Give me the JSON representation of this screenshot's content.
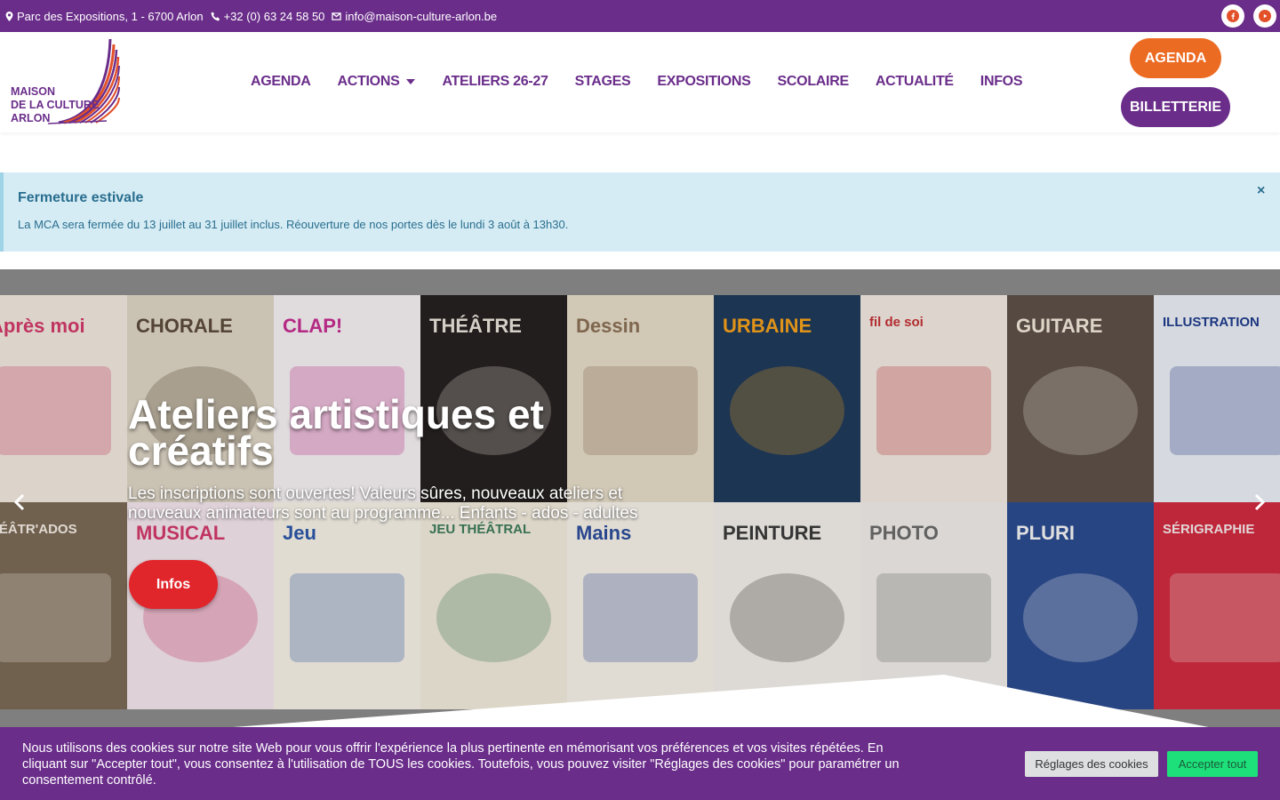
{
  "topbar": {
    "address": "Parc des Expositions, 1 - 6700 Arlon",
    "phone": "+32 (0) 63 24 58 50",
    "email": "info@maison-culture-arlon.be",
    "socials": [
      {
        "icon": "facebook-icon",
        "color": "#e2512a"
      },
      {
        "icon": "youtube-icon",
        "color": "#e2512a"
      }
    ]
  },
  "logo": {
    "line1": "MAISON",
    "line2": "DE LA CULTURE",
    "line3": "ARLON"
  },
  "nav": {
    "items": [
      {
        "label": "AGENDA"
      },
      {
        "label": "ACTIONS",
        "dropdown": true
      },
      {
        "label": "ATELIERS 26-27"
      },
      {
        "label": "STAGES"
      },
      {
        "label": "EXPOSITIONS"
      },
      {
        "label": "SCOLAIRE"
      },
      {
        "label": "ACTUALITÉ"
      },
      {
        "label": "INFOS"
      }
    ],
    "agenda_button": "AGENDA",
    "billetterie_button": "BILLETTERIE"
  },
  "notice": {
    "title": "Fermeture estivale",
    "body": "La MCA sera fermée du 13 juillet au 31 juillet inclus. Réouverture de nos portes dès le lundi 3 août à 13h30.",
    "close": "×"
  },
  "slider": {
    "title": "Ateliers artistiques et créatifs",
    "subtitle": "Les inscriptions sont ouvertes! Valeurs sûres, nouveaux ateliers et nouveaux animateurs sont au programme... Enfants - ados - adultes",
    "button": "Infos",
    "posters_row1": [
      {
        "label": "Après moi",
        "bg": "#efe6dc",
        "fg": "#d1396a"
      },
      {
        "label": "CHORALE",
        "bg": "#dcd3c3",
        "fg": "#5b4a3a"
      },
      {
        "label": "CLAP!",
        "bg": "#f3eef0",
        "fg": "#c42d8f"
      },
      {
        "label": "THÉÂTRE",
        "bg": "#262121",
        "fg": "#e8e2d8"
      },
      {
        "label": "Dessin",
        "bg": "#e3d9c6",
        "fg": "#8a6f55"
      },
      {
        "label": "URBAINE",
        "bg": "#1f3a5a",
        "fg": "#f3a01c"
      },
      {
        "label": "fil de soi",
        "bg": "#efe7df",
        "fg": "#c23035"
      },
      {
        "label": "GUITARE",
        "bg": "#5d5048",
        "fg": "#f1e8d8"
      },
      {
        "label": "ILLUSTRATION",
        "bg": "#e9edf3",
        "fg": "#1f3b8a"
      }
    ],
    "posters_row2": [
      {
        "label": "HÉÂTR'ADOS",
        "bg": "#7a6a55",
        "fg": "#f3ece3"
      },
      {
        "label": "MUSICAL",
        "bg": "#f1e3ea",
        "fg": "#d1396a"
      },
      {
        "label": "Jeu",
        "bg": "#f4efe4",
        "fg": "#2c56a8"
      },
      {
        "label": "JEU THÉÂTRAL",
        "bg": "#efe9d9",
        "fg": "#3c7a5a"
      },
      {
        "label": "Mains",
        "bg": "#f4efe6",
        "fg": "#2d4e9a"
      },
      {
        "label": "PEINTURE",
        "bg": "#f0ece6",
        "fg": "#3a3a3a"
      },
      {
        "label": "PHOTO",
        "bg": "#eeeae6",
        "fg": "#6a6a6a"
      },
      {
        "label": "PLURI",
        "bg": "#2c4b8f",
        "fg": "#f3f3f3"
      },
      {
        "label": "SÉRIGRAPHIE",
        "bg": "#cf2a3e",
        "fg": "#f6e9ea"
      }
    ]
  },
  "cookie": {
    "text": "Nous utilisons des cookies sur notre site Web pour vous offrir l'expérience la plus pertinente en mémorisant vos préférences et vos visites répétées. En cliquant sur \"Accepter tout\", vous consentez à l'utilisation de TOUS les cookies. Toutefois, vous pouvez visiter \"Réglages des cookies\" pour paramétrer un consentement contrôlé.",
    "settings_button": "Réglages des cookies",
    "accept_button": "Accepter tout"
  },
  "colors": {
    "brand_purple": "#6a2d8a",
    "brand_orange": "#ec6b23",
    "button_red": "#e0252b",
    "accept_green": "#1ee07a",
    "notice_bg": "#d5ecf4"
  }
}
